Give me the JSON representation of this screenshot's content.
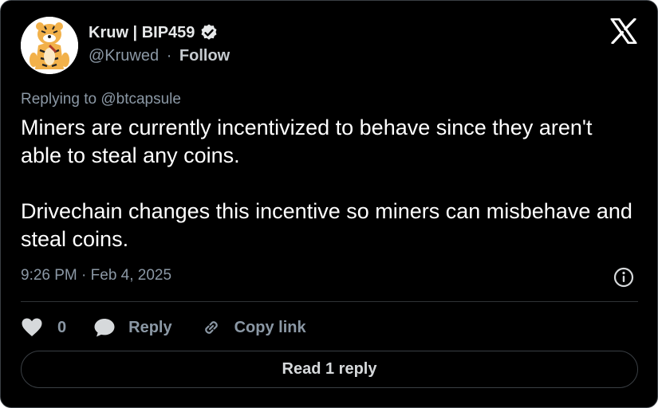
{
  "author": {
    "display_name": "Kruw | BIP459",
    "handle": "@Kruwed",
    "separator": "·",
    "follow_label": "Follow",
    "verified": true,
    "avatar_icon": "tiger-cartoon-avatar"
  },
  "tweet": {
    "replying_to": "Replying to @btcapsule",
    "paragraphs": [
      "Miners are currently incentivized to behave since they aren't able to steal any coins.",
      "Drivechain changes this incentive so miners can misbehave and steal coins."
    ],
    "timestamp": "9:26 PM · Feb 4, 2025"
  },
  "actions": {
    "like_count": "0",
    "reply_label": "Reply",
    "copy_link_label": "Copy link"
  },
  "read_replies_label": "Read 1 reply",
  "colors": {
    "background": "#000000",
    "text": "#e7e9ea",
    "muted": "#8b98a5",
    "border": "#3a3f44",
    "verified_badge": "#e7e9ea"
  }
}
